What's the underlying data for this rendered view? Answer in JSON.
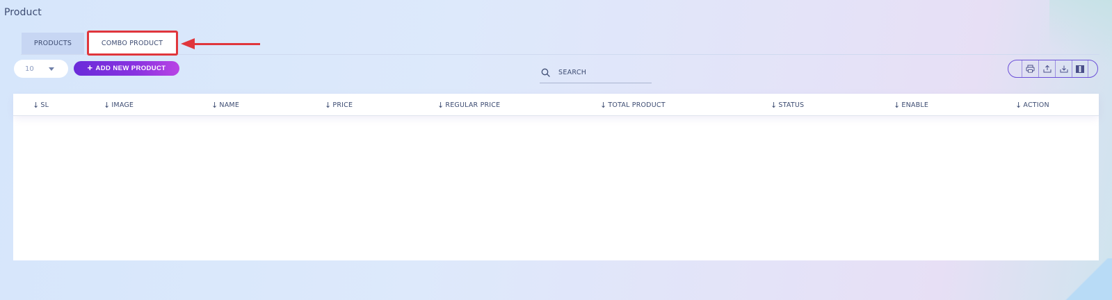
{
  "page": {
    "title": "Product"
  },
  "tabs": [
    {
      "label": "PRODUCTS",
      "active": false
    },
    {
      "label": "COMBO PRODUCT",
      "active": true
    }
  ],
  "toolbar": {
    "page_size": "10",
    "add_label": "ADD NEW PRODUCT",
    "search_placeholder": "SEARCH",
    "tools": [
      "print-icon",
      "upload-icon",
      "download-icon",
      "columns-icon"
    ]
  },
  "table": {
    "columns": [
      "SL",
      "IMAGE",
      "NAME",
      "PRICE",
      "REGULAR PRICE",
      "TOTAL PRODUCT",
      "STATUS",
      "ENABLE",
      "ACTION"
    ],
    "rows": []
  },
  "annotation": {
    "color": "#e0363c"
  },
  "colors": {
    "accent": "#7b2fde",
    "tab_inactive": "#c7d6f3"
  }
}
